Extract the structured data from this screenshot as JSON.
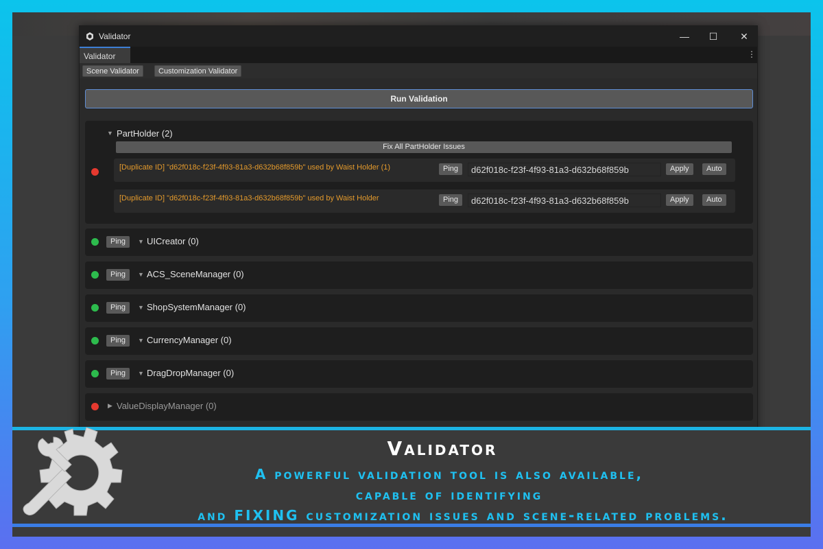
{
  "window": {
    "title": "Validator",
    "tab": "Validator",
    "controls": {
      "minimize": "—",
      "maximize": "☐",
      "close": "✕"
    },
    "kebab": "⋮"
  },
  "toolbar": {
    "scene_validator": "Scene Validator",
    "customization_validator": "Customization Validator"
  },
  "run_button": "Run Validation",
  "partholder": {
    "title": "PartHolder (2)",
    "status": "red",
    "fix_all": "Fix All PartHolder Issues",
    "issues": [
      {
        "message": "[Duplicate ID] \"d62f018c-f23f-4f93-81a3-d632b68f859b\" used by Waist Holder (1)",
        "ping": "Ping",
        "id": "d62f018c-f23f-4f93-81a3-d632b68f859b",
        "apply": "Apply",
        "auto": "Auto"
      },
      {
        "message": "[Duplicate ID] \"d62f018c-f23f-4f93-81a3-d632b68f859b\" used by Waist Holder",
        "ping": "Ping",
        "id": "d62f018c-f23f-4f93-81a3-d632b68f859b",
        "apply": "Apply",
        "auto": "Auto"
      }
    ]
  },
  "groups": [
    {
      "title": "UICreator (0)",
      "status": "green",
      "ping": "Ping"
    },
    {
      "title": "ACS_SceneManager (0)",
      "status": "green",
      "ping": "Ping"
    },
    {
      "title": "ShopSystemManager (0)",
      "status": "green",
      "ping": "Ping"
    },
    {
      "title": "CurrencyManager (0)",
      "status": "green",
      "ping": "Ping"
    },
    {
      "title": "DragDropManager (0)",
      "status": "green",
      "ping": "Ping"
    },
    {
      "title": "ValueDisplayManager (0)",
      "status": "red"
    }
  ],
  "banner": {
    "title": "Validator",
    "line1": "A powerful validation tool is also available,",
    "line2": "capable of identifying",
    "line3": "and FIXING customization issues and scene-related problems."
  },
  "colors": {
    "status_red": "#e5392f",
    "status_green": "#2dbb4d",
    "warning_text": "#e49a2c",
    "accent_cyan": "#1fc0f0",
    "accent_blue": "#3a7de6"
  }
}
